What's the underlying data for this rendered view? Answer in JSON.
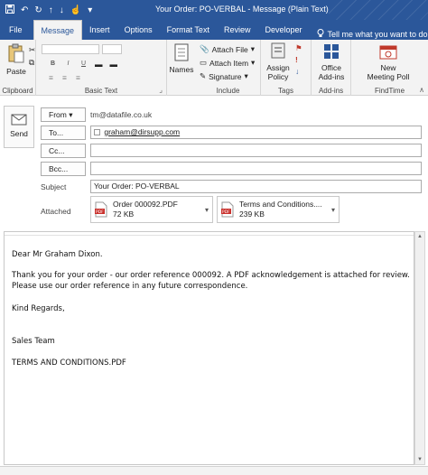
{
  "titlebar": {
    "title": "Your Order: PO-VERBAL - Message (Plain Text)"
  },
  "tabs": {
    "file": "File",
    "message": "Message",
    "insert": "Insert",
    "options": "Options",
    "format_text": "Format Text",
    "review": "Review",
    "developer": "Developer",
    "tell_me": "Tell me what you want to do"
  },
  "ribbon": {
    "paste": "Paste",
    "clipboard": "Clipboard",
    "basic_text": "Basic Text",
    "names": "Names",
    "attach_file": "Attach File",
    "attach_item": "Attach Item",
    "signature": "Signature",
    "include": "Include",
    "assign_policy_line1": "Assign",
    "assign_policy_line2": "Policy",
    "tags": "Tags",
    "office_addins_line1": "Office",
    "office_addins_line2": "Add-ins",
    "addins": "Add-ins",
    "new_meeting_poll_line1": "New",
    "new_meeting_poll_line2": "Meeting Poll",
    "findtime": "FindTime",
    "format_glyphs": [
      "B",
      "I",
      "U"
    ]
  },
  "header": {
    "send": "Send",
    "from_label": "From",
    "from_value": "tm@datafile.co.uk",
    "to_label": "To...",
    "to_value": "graham@dirsupp.com",
    "cc_label": "Cc...",
    "bcc_label": "Bcc...",
    "subject_label": "Subject",
    "subject_value": "Your Order: PO-VERBAL",
    "attached_label": "Attached"
  },
  "attachments": [
    {
      "name": "Order 000092.PDF",
      "size": "72 KB"
    },
    {
      "name": "Terms and Conditions....",
      "size": "239 KB"
    }
  ],
  "body": {
    "greeting": "Dear Mr Graham Dixon.",
    "line1": "Thank you for your order - our order reference 000092.  A PDF acknowledgement is attached for review.",
    "line2": "Please use our order reference in any future correspondence.",
    "regards": "Kind Regards,",
    "team": "Sales Team",
    "terms": "TERMS AND CONDITIONS.PDF"
  },
  "colors": {
    "brand": "#2b579a",
    "pdf_red": "#c9302c"
  }
}
